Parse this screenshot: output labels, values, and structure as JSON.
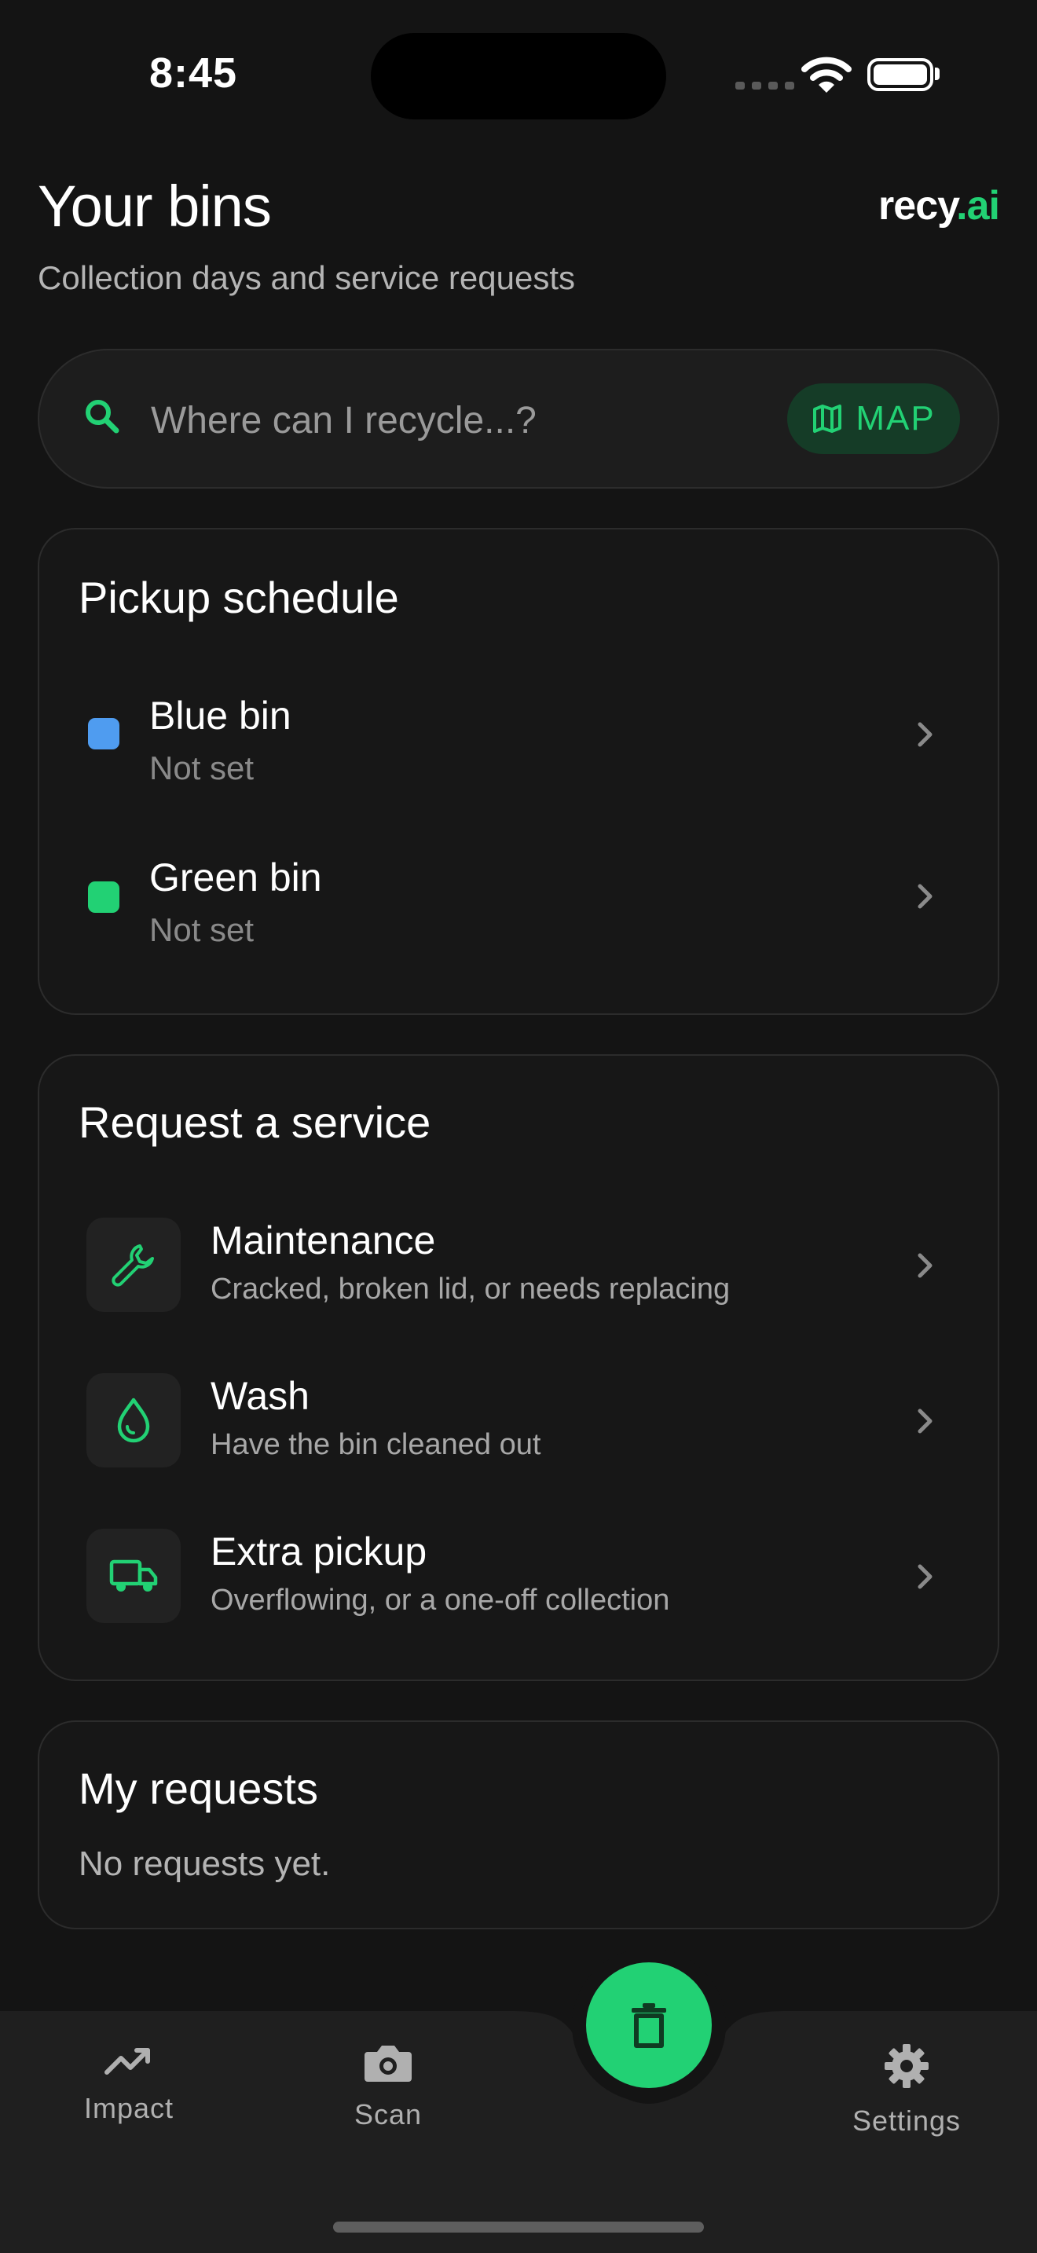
{
  "status": {
    "time": "8:45"
  },
  "header": {
    "title": "Your bins",
    "subtitle": "Collection days and service requests",
    "logo_main": "recy",
    "logo_accent": ".ai"
  },
  "search": {
    "placeholder": "Where can I recycle...?",
    "map_label": "MAP"
  },
  "pickup": {
    "title": "Pickup schedule",
    "bins": [
      {
        "label": "Blue bin",
        "status": "Not set",
        "color": "#4f9cf0"
      },
      {
        "label": "Green bin",
        "status": "Not set",
        "color": "#22d174"
      }
    ]
  },
  "service": {
    "title": "Request a service",
    "items": [
      {
        "label": "Maintenance",
        "desc": "Cracked, broken lid, or needs replacing",
        "icon": "wrench-icon"
      },
      {
        "label": "Wash",
        "desc": "Have the bin cleaned out",
        "icon": "droplet-icon"
      },
      {
        "label": "Extra pickup",
        "desc": "Overflowing, or a one-off collection",
        "icon": "truck-icon"
      }
    ]
  },
  "requests": {
    "title": "My requests",
    "empty": "No requests yet."
  },
  "nav": {
    "impact": "Impact",
    "scan": "Scan",
    "settings": "Settings",
    "bins_icon": "trash-icon"
  },
  "colors": {
    "accent": "#22d174",
    "background": "#141414",
    "card": "#171717"
  }
}
